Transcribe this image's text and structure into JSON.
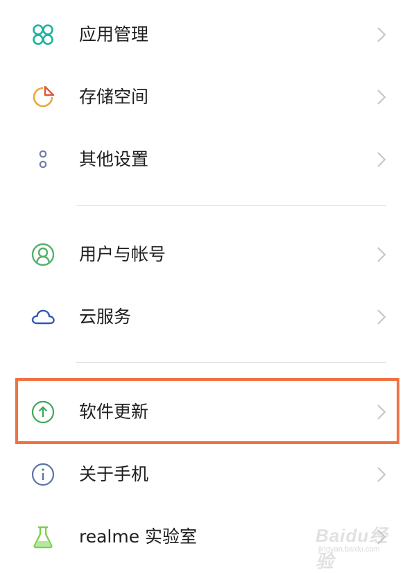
{
  "settings_items": [
    {
      "label": "应用管理",
      "icon": "app-grid-icon",
      "color": "#1bb3a0"
    },
    {
      "label": "存储空间",
      "icon": "storage-pie-icon",
      "color": "#e9a93a"
    },
    {
      "label": "其他设置",
      "icon": "more-dots-icon",
      "color": "#6f7fa8"
    },
    {
      "label": "用户与帐号",
      "icon": "user-account-icon",
      "color": "#55b06b"
    },
    {
      "label": "云服务",
      "icon": "cloud-icon",
      "color": "#2f56b8"
    },
    {
      "label": "软件更新",
      "icon": "upload-arrow-icon",
      "color": "#3fa85a"
    },
    {
      "label": "关于手机",
      "icon": "info-icon",
      "color": "#5b73a6"
    },
    {
      "label": "realme 实验室",
      "icon": "flask-icon",
      "color": "#7ccf4a"
    }
  ],
  "highlight": {
    "target": "软件更新",
    "color": "#f07142"
  },
  "watermark": {
    "brand": "Baidu经验",
    "url": "jingyan.baidu.com"
  }
}
